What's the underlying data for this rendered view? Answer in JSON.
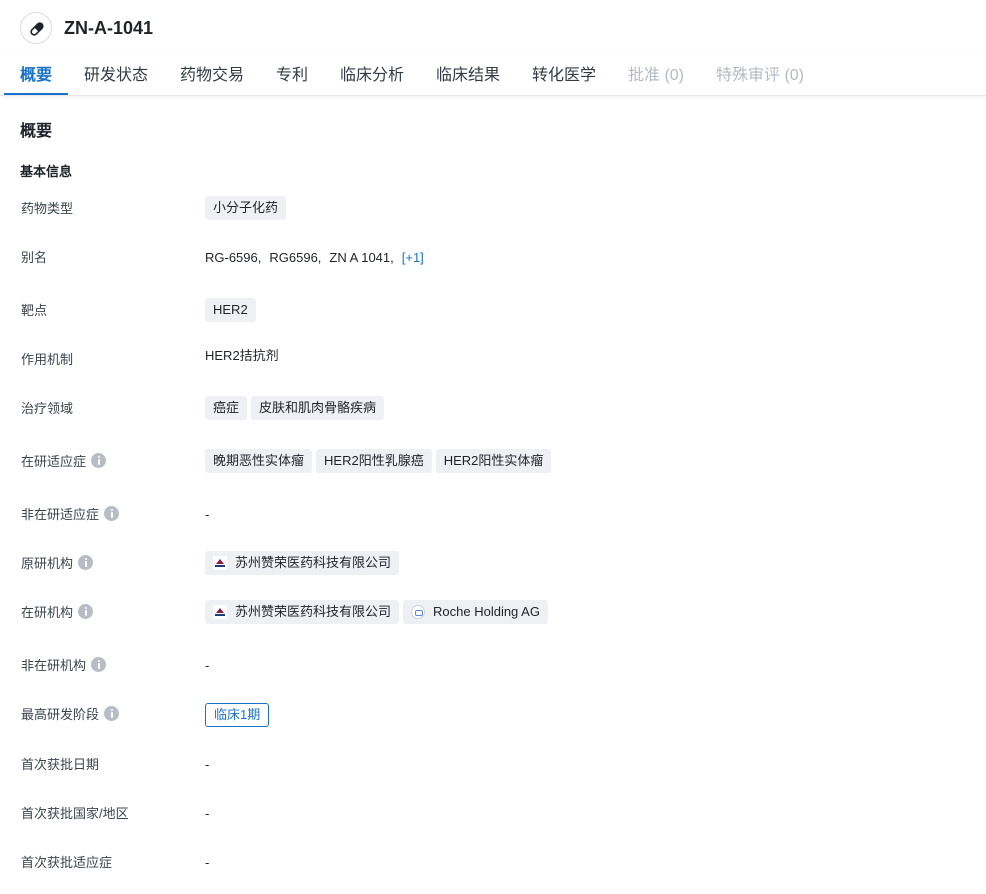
{
  "header": {
    "title": "ZN-A-1041",
    "icon": "pill-icon"
  },
  "tabs": [
    {
      "label": "概要",
      "state": "active"
    },
    {
      "label": "研发状态",
      "state": "normal"
    },
    {
      "label": "药物交易",
      "state": "normal"
    },
    {
      "label": "专利",
      "state": "normal"
    },
    {
      "label": "临床分析",
      "state": "normal"
    },
    {
      "label": "临床结果",
      "state": "normal"
    },
    {
      "label": "转化医学",
      "state": "normal"
    },
    {
      "label": "批准 (0)",
      "state": "disabled"
    },
    {
      "label": "特殊审评 (0)",
      "state": "disabled"
    }
  ],
  "section_title": "概要",
  "subsection_title": "基本信息",
  "rows": {
    "drug_type": {
      "label": "药物类型",
      "tags": [
        "小分子化药"
      ]
    },
    "aliases": {
      "label": "别名",
      "items": [
        "RG-6596,",
        "RG6596,",
        "ZN A 1041,"
      ],
      "more": "[+1]"
    },
    "target": {
      "label": "靶点",
      "tags": [
        "HER2"
      ]
    },
    "mechanism": {
      "label": "作用机制",
      "value": "HER2拮抗剂"
    },
    "therapy_area": {
      "label": "治疗领域",
      "tags": [
        "癌症",
        "皮肤和肌肉骨骼疾病"
      ]
    },
    "active_indications": {
      "label": "在研适应症",
      "tags": [
        "晚期恶性实体瘤",
        "HER2阳性乳腺癌",
        "HER2阳性实体瘤"
      ]
    },
    "inactive_indications": {
      "label": "非在研适应症",
      "value": "-"
    },
    "originator": {
      "label": "原研机构",
      "orgs": [
        {
          "name": "苏州赞荣医药科技有限公司",
          "logo": "zn-logo"
        }
      ]
    },
    "active_orgs": {
      "label": "在研机构",
      "orgs": [
        {
          "name": "苏州赞荣医药科技有限公司",
          "logo": "zn-logo"
        },
        {
          "name": "Roche Holding AG",
          "logo": "roche-logo"
        }
      ]
    },
    "inactive_orgs": {
      "label": "非在研机构",
      "value": "-"
    },
    "highest_phase": {
      "label": "最高研发阶段",
      "value": "临床1期"
    },
    "first_approval_date": {
      "label": "首次获批日期",
      "value": "-"
    },
    "first_approval_region": {
      "label": "首次获批国家/地区",
      "value": "-"
    },
    "first_approval_indication": {
      "label": "首次获批适应症",
      "value": "-"
    }
  },
  "colors": {
    "accent": "#1a73c8",
    "tag_bg": "#eef0f3",
    "disabled": "#b5bac2"
  }
}
